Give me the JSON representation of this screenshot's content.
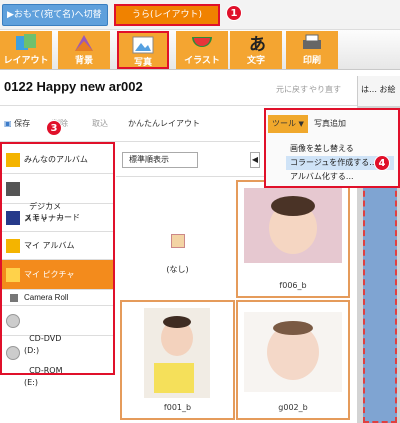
{
  "modes": {
    "omote": "▶おもて(宛て名)へ切替",
    "ura": "うら(レイアウト)"
  },
  "toolbar": [
    "レイアウト",
    "背景",
    "写真",
    "イラスト",
    "文字",
    "印刷"
  ],
  "badges": [
    "1",
    "2",
    "3",
    "4"
  ],
  "document": {
    "title": "0122  Happy new  ar002",
    "undo": "元に戻す",
    "redo": "やり直す",
    "right_label": "は… お絵"
  },
  "actions": [
    "保存",
    "削除",
    "取込",
    "かんたんレイアウト"
  ],
  "tools_menu": {
    "button": "ツール",
    "add_photo": "写真追加",
    "items": [
      "画像を差し替える",
      "コラージュを作成する...",
      "アルバム化する..."
    ]
  },
  "sidebar": [
    "みんなのアルバム",
    "デジカメ\nスキャナー",
    "メモリーカード",
    "マイ アルバム",
    "マイ ピクチャ",
    "Camera Roll",
    "CD-DVD\n(D:)",
    "CD-ROM\n(E:)"
  ],
  "center": {
    "sort": "標準順表示",
    "pager": "◀"
  },
  "photos": [
    "(なし)",
    "f006_b",
    "f001_b",
    "g002_b"
  ],
  "colors": {
    "accent": "#f08200",
    "callout": "#e0102a",
    "toolbar_bg": "#f4a531",
    "selected_row": "#f38b1c"
  }
}
